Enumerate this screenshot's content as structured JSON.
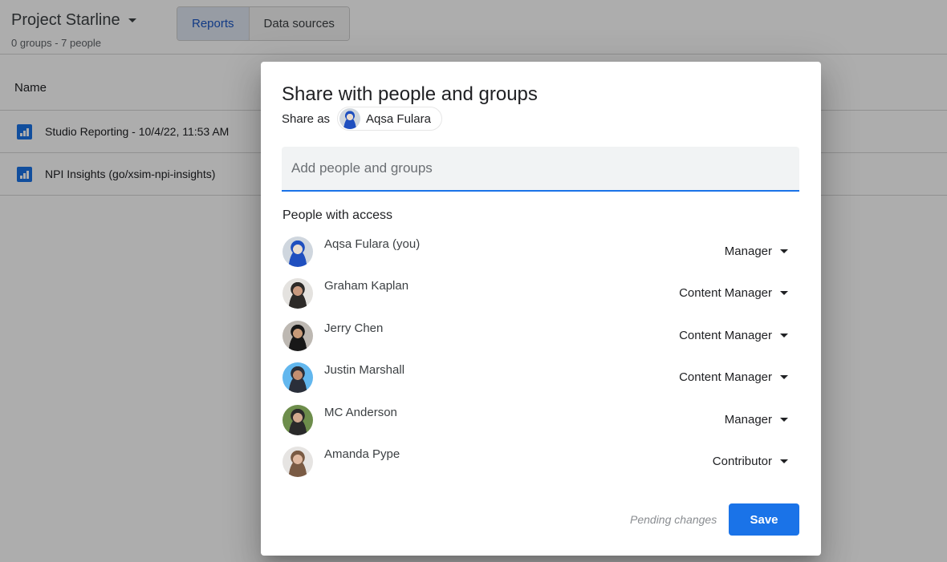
{
  "header": {
    "project_title": "Project Starline",
    "project_subtitle": "0 groups - 7 people",
    "tabs": [
      {
        "label": "Reports",
        "active": true
      },
      {
        "label": "Data sources",
        "active": false
      }
    ]
  },
  "list": {
    "column_name": "Name",
    "rows": [
      {
        "icon": "report-chart-icon",
        "label": "Studio Reporting - 10/4/22, 11:53 AM"
      },
      {
        "icon": "report-chart-icon",
        "label": "NPI Insights (go/xsim-npi-insights)"
      }
    ]
  },
  "dialog": {
    "title": "Share with people and groups",
    "share_as_label": "Share as",
    "share_as_name": "Aqsa Fulara",
    "add_field": {
      "value": "",
      "placeholder": "Add people and groups"
    },
    "access_title": "People with access",
    "people": [
      {
        "name": "Aqsa Fulara (you)",
        "role": "Manager",
        "avatar_colors": [
          "#cfd6de",
          "#1f4fbf",
          "#e8dcd0"
        ]
      },
      {
        "name": "Graham Kaplan",
        "role": "Content Manager",
        "avatar_colors": [
          "#e4e2df",
          "#2d2a28",
          "#c99a7f"
        ]
      },
      {
        "name": "Jerry Chen",
        "role": "Content Manager",
        "avatar_colors": [
          "#bdb8b2",
          "#181818",
          "#c79a78"
        ]
      },
      {
        "name": "Justin Marshall",
        "role": "Content Manager",
        "avatar_colors": [
          "#62b7ee",
          "#2a2f3a",
          "#c48e70"
        ]
      },
      {
        "name": "MC Anderson",
        "role": "Manager",
        "avatar_colors": [
          "#6d8d4b",
          "#2a2a2a",
          "#d2a98f"
        ]
      },
      {
        "name": "Amanda Pype",
        "role": "Contributor",
        "avatar_colors": [
          "#e6e4e2",
          "#7a5b44",
          "#e0b9a0"
        ]
      }
    ],
    "pending_text": "Pending changes",
    "save_label": "Save"
  },
  "colors": {
    "accent": "#1a73e8",
    "active_tab_text": "#1a56c4"
  }
}
